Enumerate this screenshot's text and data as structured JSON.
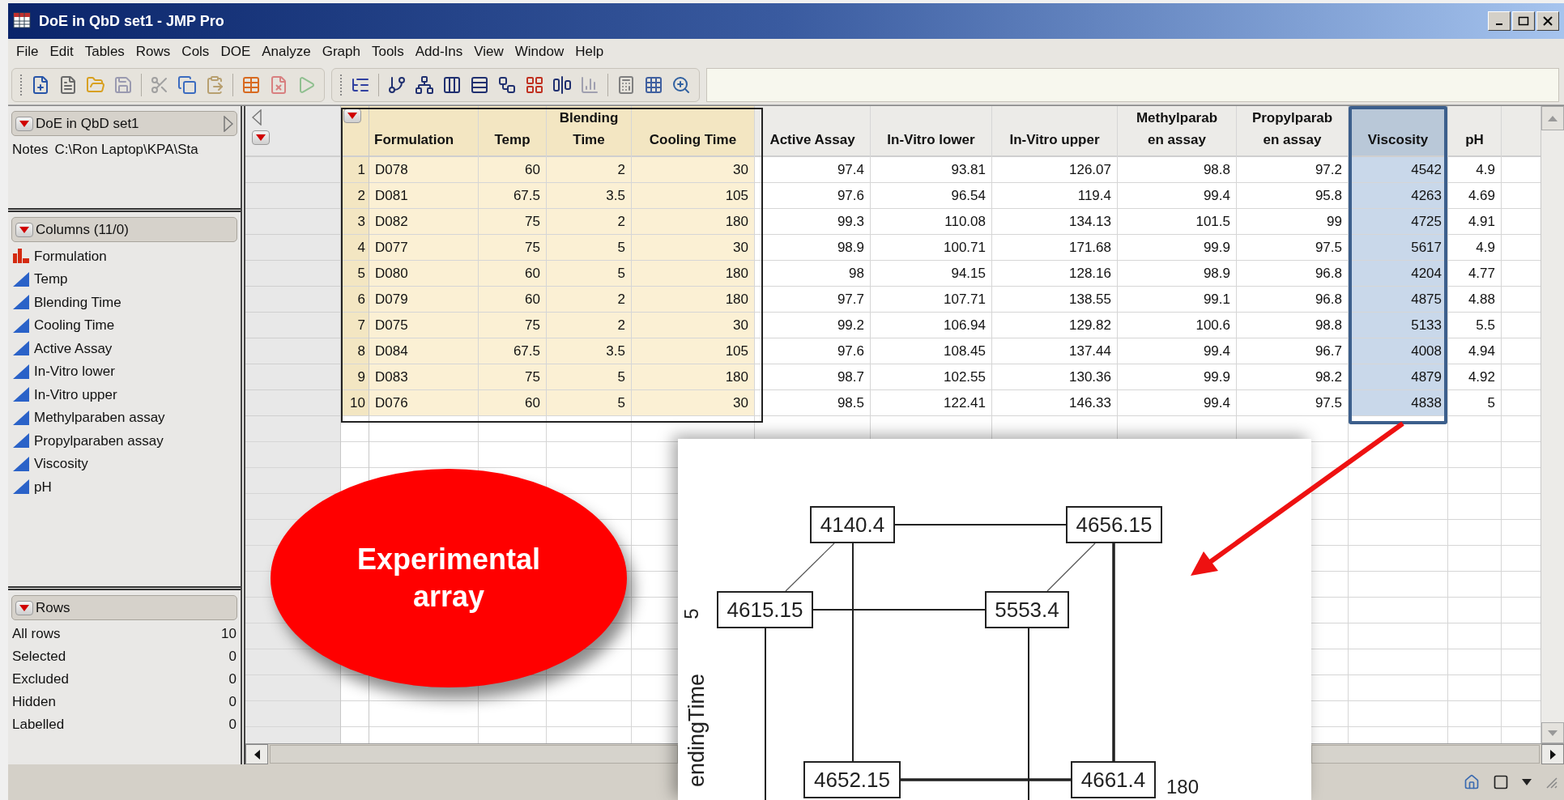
{
  "window": {
    "title": "DoE in QbD set1 - JMP Pro"
  },
  "menu": [
    "File",
    "Edit",
    "Tables",
    "Rows",
    "Cols",
    "DOE",
    "Analyze",
    "Graph",
    "Tools",
    "Add-Ins",
    "View",
    "Window",
    "Help"
  ],
  "table_panel": {
    "title": "DoE in QbD set1",
    "notes_label": "Notes",
    "notes_value": "C:\\Ron Laptop\\KPA\\Sta"
  },
  "columns_panel": {
    "title": "Columns (11/0)",
    "items": [
      {
        "name": "Formulation",
        "kind": "nominal"
      },
      {
        "name": "Temp",
        "kind": "continuous"
      },
      {
        "name": "Blending Time",
        "kind": "continuous"
      },
      {
        "name": "Cooling Time",
        "kind": "continuous"
      },
      {
        "name": "Active Assay",
        "kind": "continuous"
      },
      {
        "name": "In-Vitro lower",
        "kind": "continuous"
      },
      {
        "name": "In-Vitro upper",
        "kind": "continuous"
      },
      {
        "name": "Methylparaben assay",
        "kind": "continuous"
      },
      {
        "name": "Propylparaben assay",
        "kind": "continuous"
      },
      {
        "name": "Viscosity",
        "kind": "continuous"
      },
      {
        "name": "pH",
        "kind": "continuous"
      }
    ]
  },
  "rows_panel": {
    "title": "Rows",
    "items": [
      {
        "label": "All rows",
        "count": "10"
      },
      {
        "label": "Selected",
        "count": "0"
      },
      {
        "label": "Excluded",
        "count": "0"
      },
      {
        "label": "Hidden",
        "count": "0"
      },
      {
        "label": "Labelled",
        "count": "0"
      }
    ]
  },
  "table": {
    "columns": [
      {
        "header": [
          "Formulation"
        ],
        "kind": "character",
        "highlighted": true,
        "selected": false
      },
      {
        "header": [
          "Temp"
        ],
        "kind": "numeric",
        "highlighted": true,
        "selected": false
      },
      {
        "header": [
          "Blending",
          "Time"
        ],
        "kind": "numeric",
        "highlighted": true,
        "selected": false
      },
      {
        "header": [
          "Cooling Time"
        ],
        "kind": "numeric",
        "highlighted": true,
        "selected": false
      },
      {
        "header": [
          "Active Assay"
        ],
        "kind": "numeric",
        "highlighted": false,
        "selected": false
      },
      {
        "header": [
          "In-Vitro lower"
        ],
        "kind": "numeric",
        "highlighted": false,
        "selected": false
      },
      {
        "header": [
          "In-Vitro upper"
        ],
        "kind": "numeric",
        "highlighted": false,
        "selected": false
      },
      {
        "header": [
          "Methylparab",
          "en assay"
        ],
        "kind": "numeric",
        "highlighted": false,
        "selected": false
      },
      {
        "header": [
          "Propylparab",
          "en assay"
        ],
        "kind": "numeric",
        "highlighted": false,
        "selected": false
      },
      {
        "header": [
          "Viscosity"
        ],
        "kind": "numeric",
        "highlighted": false,
        "selected": true
      },
      {
        "header": [
          "pH"
        ],
        "kind": "numeric",
        "highlighted": false,
        "selected": false
      }
    ],
    "rows": [
      {
        "number": "1",
        "cells": [
          "D078",
          "60",
          "2",
          "30",
          "97.4",
          "93.81",
          "126.07",
          "98.8",
          "97.2",
          "4542",
          "4.9"
        ]
      },
      {
        "number": "2",
        "cells": [
          "D081",
          "67.5",
          "3.5",
          "105",
          "97.6",
          "96.54",
          "119.4",
          "99.4",
          "95.8",
          "4263",
          "4.69"
        ]
      },
      {
        "number": "3",
        "cells": [
          "D082",
          "75",
          "2",
          "180",
          "99.3",
          "110.08",
          "134.13",
          "101.5",
          "99",
          "4725",
          "4.91"
        ]
      },
      {
        "number": "4",
        "cells": [
          "D077",
          "75",
          "5",
          "30",
          "98.9",
          "100.71",
          "171.68",
          "99.9",
          "97.5",
          "5617",
          "4.9"
        ]
      },
      {
        "number": "5",
        "cells": [
          "D080",
          "60",
          "5",
          "180",
          "98",
          "94.15",
          "128.16",
          "98.9",
          "96.8",
          "4204",
          "4.77"
        ]
      },
      {
        "number": "6",
        "cells": [
          "D079",
          "60",
          "2",
          "180",
          "97.7",
          "107.71",
          "138.55",
          "99.1",
          "96.8",
          "4875",
          "4.88"
        ]
      },
      {
        "number": "7",
        "cells": [
          "D075",
          "75",
          "2",
          "30",
          "99.2",
          "106.94",
          "129.82",
          "100.6",
          "98.8",
          "5133",
          "5.5"
        ]
      },
      {
        "number": "8",
        "cells": [
          "D084",
          "67.5",
          "3.5",
          "105",
          "97.6",
          "108.45",
          "137.44",
          "99.4",
          "96.7",
          "4008",
          "4.94"
        ]
      },
      {
        "number": "9",
        "cells": [
          "D083",
          "75",
          "5",
          "180",
          "98.7",
          "102.55",
          "130.36",
          "99.9",
          "98.2",
          "4879",
          "4.92"
        ]
      },
      {
        "number": "10",
        "cells": [
          "D076",
          "60",
          "5",
          "30",
          "98.5",
          "122.41",
          "146.33",
          "99.4",
          "97.5",
          "4838",
          "5"
        ]
      }
    ]
  },
  "callout": {
    "lines": [
      "Experimental",
      "array"
    ]
  },
  "cube_plot": {
    "corners": [
      "4140.4",
      "4656.15",
      "4615.15",
      "5553.4",
      "4652.15",
      "4661.4"
    ],
    "axis_value": "5",
    "axis_title": "endingTime",
    "corner_label": "180"
  }
}
